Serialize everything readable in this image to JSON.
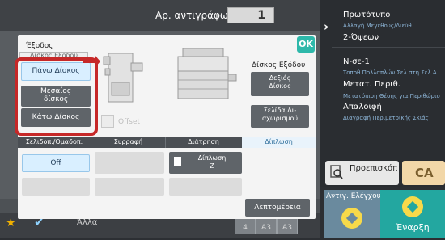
{
  "header": {
    "copies_label": "Αρ. αντιγράφων",
    "copies_value": "1"
  },
  "dialog": {
    "title": "Έξοδος",
    "ok_label": "OK",
    "tray_header": "Δίσκος Εξόδου",
    "trays": {
      "top": "Πάνω Δίσκος",
      "middle_l1": "Μεσαίος",
      "middle_l2": "δίσκος",
      "lower": "Κάτω Δίσκος"
    },
    "offset_label": "Offset",
    "output_tray_label": "Δίσκος Εξόδου",
    "right_tray_l1": "Δεξιός",
    "right_tray_l2": "Δίσκος",
    "separator_l1": "Σελίδα Δι-",
    "separator_l2": "αχωρισμού",
    "tabs": [
      "Σελιδοπ./Ομαδοπ.",
      "Συρραφή",
      "Διάτρηση",
      "Δίπλωση"
    ],
    "off_label": "Off",
    "fold_l1": "Δίπλωση",
    "fold_l2": "Z",
    "details_label": "Λεπτομέρεια"
  },
  "right_panel": {
    "items": [
      {
        "title": "Πρωτότυπο",
        "sub": "Αλλαγή Μεγέθους/Διεύθ"
      },
      {
        "title": "2-Όψεων",
        "sub": ""
      },
      {
        "title": "N-σε-1",
        "sub": "Τοποθ Πολλαπλών Σελ στη Σελ Α"
      },
      {
        "title": "Μετατ. Περιθ.",
        "sub": "Μετατόπιση Θέσης για Περιθώριο"
      },
      {
        "title": "Απαλοιφή",
        "sub": "Διαγραφή Περιμετρικής Σκιάς"
      }
    ],
    "preview_label": "Προεπισκόπ",
    "ca_label": "CA",
    "proof_label": "Αντιγ. Ελέγχου",
    "start_label": "Έναρξη"
  },
  "status_bar": {
    "other_label": "Άλλα",
    "trays": [
      "4",
      "A3",
      "A3"
    ]
  },
  "colors": {
    "accent": "#2eb8aa",
    "selection_highlight": "#c62828",
    "selected_button": "#d9efff",
    "start_button": "#23a7a0",
    "ca_button": "#f2d7a8"
  }
}
